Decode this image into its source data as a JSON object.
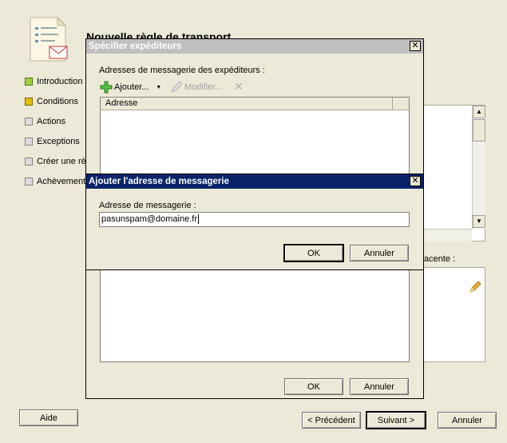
{
  "wizard": {
    "title": "Nouvelle règle de transport",
    "nav": [
      {
        "label": "Introduction",
        "state": "done"
      },
      {
        "label": "Conditions",
        "state": "active"
      },
      {
        "label": "Actions",
        "state": "pending"
      },
      {
        "label": "Exceptions",
        "state": "pending"
      },
      {
        "label": "Créer une rè",
        "state": "pending"
      },
      {
        "label": "Achèvement",
        "state": "pending"
      }
    ],
    "partial_label": "acente :",
    "help_button": "Aide",
    "back_button": "< Précédent",
    "next_button": "Suivant >",
    "cancel_button": "Annuler"
  },
  "senders_dialog": {
    "title": "Spécifier expéditeurs",
    "list_label": "Adresses de messagerie des expéditeurs :",
    "add_button": "Ajouter...",
    "edit_button": "Modifier...",
    "column_header": "Adresse",
    "ok_button": "OK",
    "cancel_button": "Annuler"
  },
  "add_dialog": {
    "title": "Ajouter l'adresse de messagerie",
    "field_label": "Adresse de messagerie :",
    "field_value": "pasunspam@domaine.fr",
    "ok_button": "OK",
    "cancel_button": "Annuler"
  }
}
